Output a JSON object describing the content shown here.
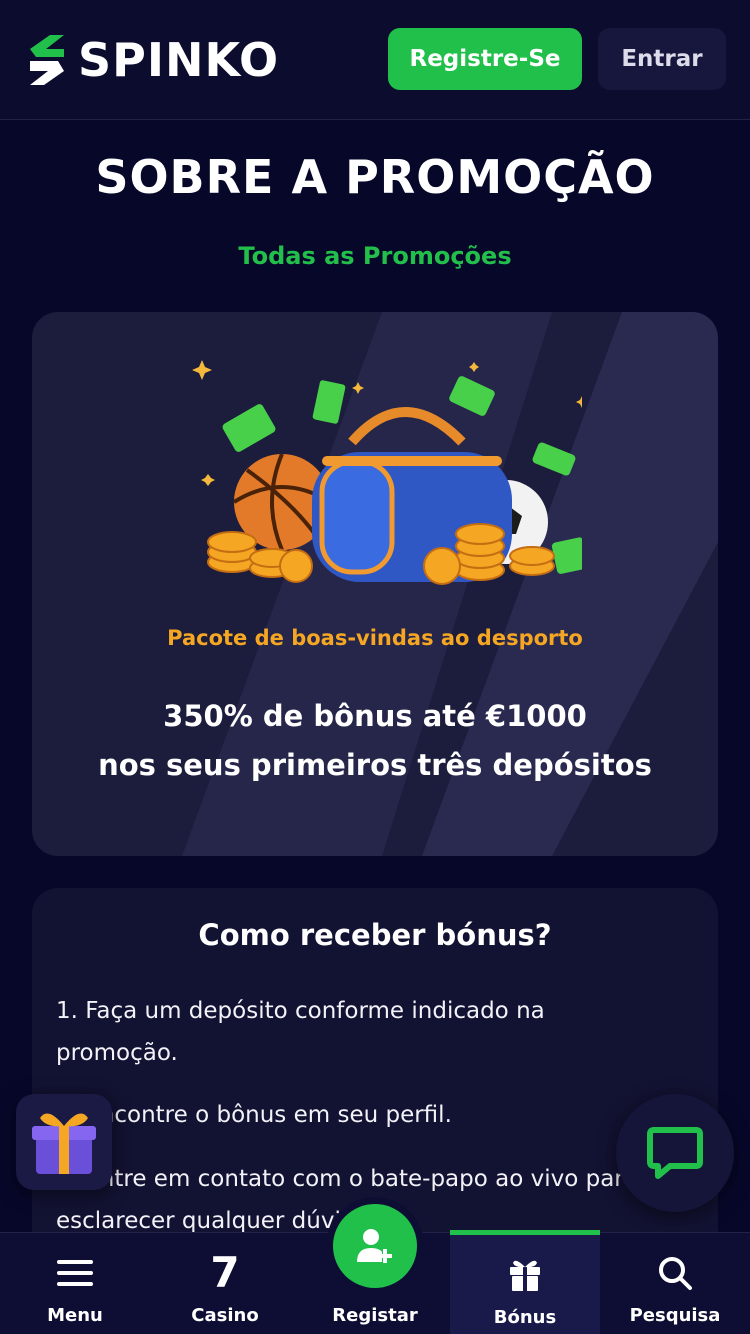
{
  "header": {
    "brand": "SPINKO",
    "register_label": "Registre-Se",
    "login_label": "Entrar"
  },
  "page": {
    "title": "SOBRE A PROMOÇÃO",
    "all_promotions_link": "Todas as Promoções"
  },
  "promo": {
    "subtitle": "Pacote de boas-vindas ao desporto",
    "headline_line1": "350% de bônus até €1000",
    "headline_line2": "nos seus primeiros três depósitos"
  },
  "howto": {
    "title": "Como receber bónus?",
    "step1_line1": "1. Faça um depósito conforme indicado na",
    "step1_line2": "promoção.",
    "step2": "2. Encontre o bônus em seu perfil.",
    "step3_line1": "3. Entre em contato com o bate-papo ao vivo para",
    "step3_line2": "esclarecer qualquer dúvida."
  },
  "bottom_nav": {
    "menu": "Menu",
    "casino": "Casino",
    "casino_icon_glyph": "7",
    "register": "Registar",
    "bonus": "Bónus",
    "search": "Pesquisa"
  },
  "colors": {
    "accent_green": "#21c04b",
    "promo_orange": "#f5a623",
    "background": "#07072a"
  },
  "icons": [
    "spinko-logo-icon",
    "gift-icon",
    "chat-icon",
    "menu-icon",
    "casino-seven-icon",
    "add-user-icon",
    "bonus-gift-icon",
    "search-icon"
  ]
}
